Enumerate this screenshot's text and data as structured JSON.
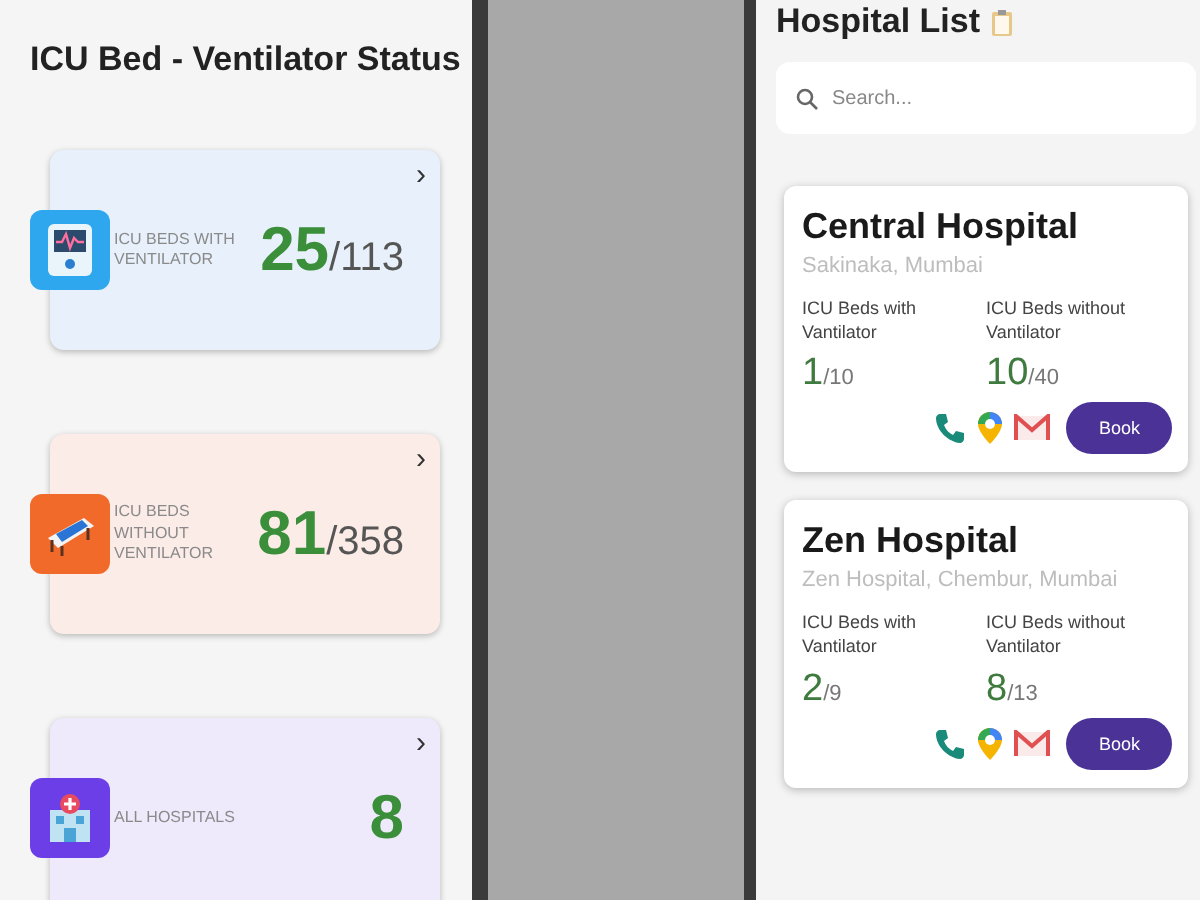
{
  "left_screen": {
    "title": "ICU Bed - Ventilator Status",
    "stat_cards": [
      {
        "kind": "ventilator",
        "label": "ICU BEDS WITH VENTILATOR",
        "available": "25",
        "total": "/113",
        "color": "#e8f1fb",
        "arrow": "›"
      },
      {
        "kind": "bed",
        "label": "ICU BEDS WITHOUT VENTILATOR",
        "available": "81",
        "total": "/358",
        "color": "#fcece7",
        "arrow": "›"
      },
      {
        "kind": "hospital",
        "label": "ALL HOSPITALS",
        "available": "8",
        "color": "#efeafb",
        "arrow": "›"
      }
    ]
  },
  "right_screen": {
    "title": "Hospital List",
    "search": {
      "placeholder": "Search..."
    },
    "hospitals": [
      {
        "name": "Central Hospital",
        "address": "Sakinaka, Mumbai",
        "with_label": "ICU Beds with Vantilator",
        "with_available": "1",
        "with_total": "/10",
        "without_label": "ICU Beds without Vantilator",
        "without_available": "10",
        "without_total": "/40",
        "button": "Book"
      },
      {
        "name": "Zen Hospital",
        "address": "Zen Hospital, Chembur, Mumbai",
        "with_label": "ICU Beds with Vantilator",
        "with_available": "2",
        "with_total": "/9",
        "without_label": "ICU Beds without Vantilator",
        "without_available": "8",
        "without_total": "/13",
        "button": "Book"
      }
    ]
  }
}
